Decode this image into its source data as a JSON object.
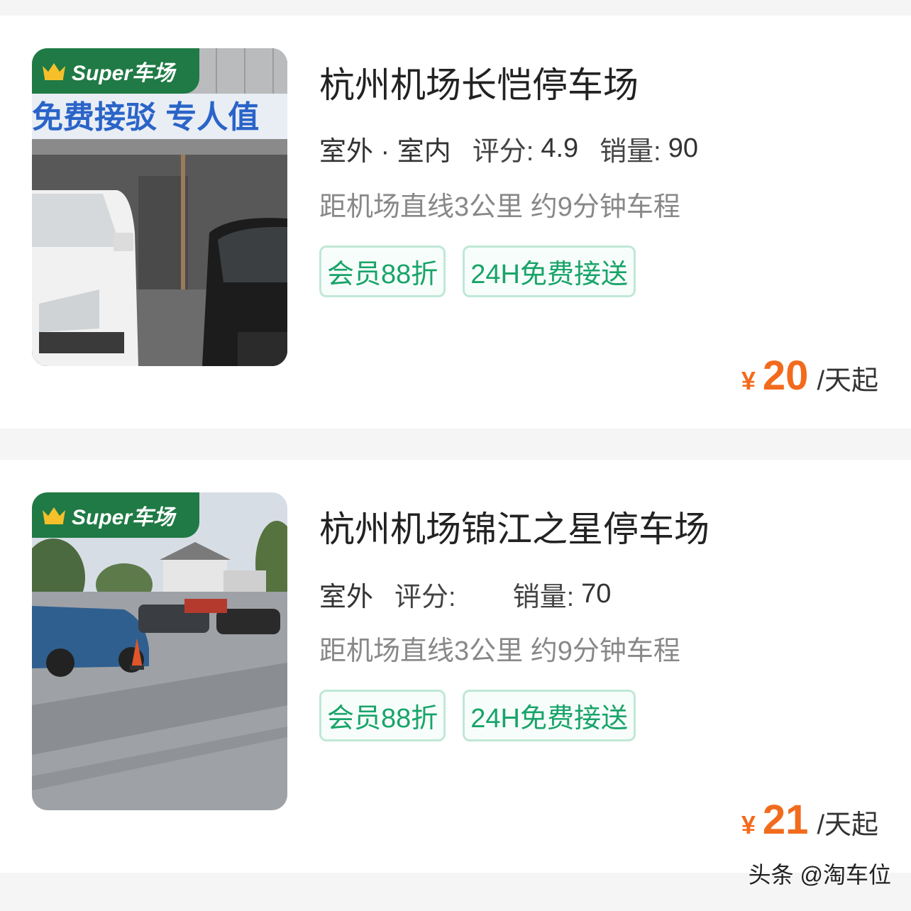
{
  "badge_text": "Super车场",
  "listings": [
    {
      "title": "杭州机场长恺停车场",
      "environment": "室外 · 室内",
      "rating_label": "评分:",
      "rating_value": "4.9",
      "sales_label": "销量:",
      "sales_value": "90",
      "distance": "距机场直线3公里 约9分钟车程",
      "tags": [
        "会员88折",
        "24H免费接送"
      ],
      "currency": "¥",
      "price": "20",
      "price_unit": "/天起",
      "photo_banner": "免费接驳 专人值"
    },
    {
      "title": "杭州机场锦江之星停车场",
      "environment": "室外",
      "rating_label": "评分:",
      "rating_value": "",
      "sales_label": "销量:",
      "sales_value": "70",
      "distance": "距机场直线3公里 约9分钟车程",
      "tags": [
        "会员88折",
        "24H免费接送"
      ],
      "currency": "¥",
      "price": "21",
      "price_unit": "/天起"
    }
  ],
  "watermark": "头条 @淘车位",
  "colors": {
    "accent_green": "#19a46a",
    "price_orange": "#f26b1d",
    "badge_green": "#1f7a45"
  }
}
